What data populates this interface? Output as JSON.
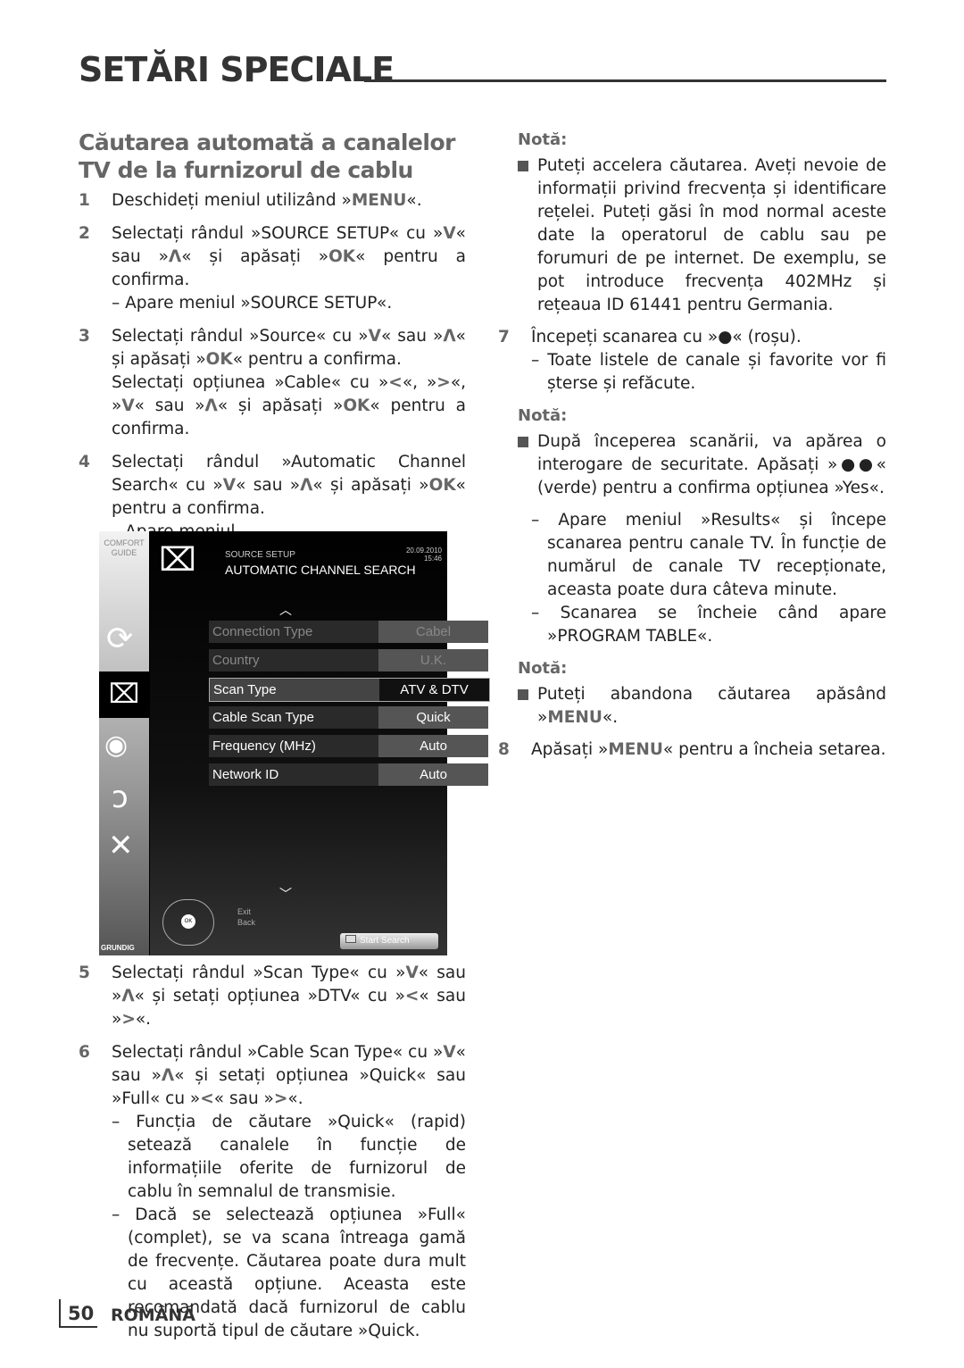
{
  "page_title": "SETĂRI SPECIALE",
  "section_heading": "Căutarea automată a canalelor TV de la furnizorul de cablu",
  "left_steps_top": [
    {
      "num": "1",
      "lines": [
        [
          {
            "t": "Deschideți meniul utilizând »"
          },
          {
            "t": "MENU",
            "k": true
          },
          {
            "t": "«."
          }
        ]
      ]
    },
    {
      "num": "2",
      "lines": [
        [
          {
            "t": "Selectați rândul »SOURCE SETUP« cu »"
          },
          {
            "t": "V",
            "k": true
          },
          {
            "t": "« sau »"
          },
          {
            "t": "Λ",
            "k": true
          },
          {
            "t": "« și apăsați »"
          },
          {
            "t": "OK",
            "k": true
          },
          {
            "t": "« pentru a confirma."
          }
        ]
      ],
      "subs": [
        "– Apare meniul »SOURCE SETUP«."
      ]
    },
    {
      "num": "3",
      "lines": [
        [
          {
            "t": "Selectați rândul »Source« cu »"
          },
          {
            "t": "V",
            "k": true
          },
          {
            "t": "« sau »"
          },
          {
            "t": "Λ",
            "k": true
          },
          {
            "t": "« și apăsați »"
          },
          {
            "t": "OK",
            "k": true
          },
          {
            "t": "« pentru a confirma."
          }
        ],
        [
          {
            "t": "Selectați opțiunea »Cable« cu »"
          },
          {
            "t": "<",
            "k": true
          },
          {
            "t": "«, »"
          },
          {
            "t": ">",
            "k": true
          },
          {
            "t": "«, »"
          },
          {
            "t": "V",
            "k": true
          },
          {
            "t": "« sau »"
          },
          {
            "t": "Λ",
            "k": true
          },
          {
            "t": "« și apăsați »"
          },
          {
            "t": "OK",
            "k": true
          },
          {
            "t": "« pentru a confirma."
          }
        ]
      ]
    },
    {
      "num": "4",
      "lines": [
        [
          {
            "t": "Selectați rândul »Automatic Channel Search« cu »"
          },
          {
            "t": "V",
            "k": true
          },
          {
            "t": "« sau »"
          },
          {
            "t": "Λ",
            "k": true
          },
          {
            "t": "« și apăsați »"
          },
          {
            "t": "OK",
            "k": true
          },
          {
            "t": "« pentru a confirma."
          }
        ]
      ],
      "subs": [
        "– Apare meniul."
      ]
    }
  ],
  "tv_menu": {
    "comfort_guide": "COMFORT GUIDE",
    "source_label": "SOURCE SETUP",
    "menu_title": "AUTOMATIC CHANNEL SEARCH",
    "date": "20.09.2010",
    "time": "15:46",
    "rows": [
      {
        "label": "Connection Type",
        "value": "Cabel",
        "state": "disabled"
      },
      {
        "label": "Country",
        "value": "U.K.",
        "state": "disabled"
      },
      {
        "label": "Scan Type",
        "value": "ATV & DTV",
        "state": "selected"
      },
      {
        "label": "Cable Scan Type",
        "value": "Quick",
        "state": "normal"
      },
      {
        "label": "Frequency (MHz)",
        "value": "Auto",
        "state": "normal"
      },
      {
        "label": "Network ID",
        "value": "Auto",
        "state": "normal"
      }
    ],
    "exit_label": "Exit",
    "back_label": "Back",
    "ok_label": "OK",
    "start_search": "Start Search",
    "brand": "GRUNDIG"
  },
  "left_steps_bottom": [
    {
      "num": "5",
      "lines": [
        [
          {
            "t": "Selectați rândul »Scan Type« cu »"
          },
          {
            "t": "V",
            "k": true
          },
          {
            "t": "« sau »"
          },
          {
            "t": "Λ",
            "k": true
          },
          {
            "t": "« și setați opțiunea »DTV« cu »"
          },
          {
            "t": "<",
            "k": true
          },
          {
            "t": "« sau »"
          },
          {
            "t": ">",
            "k": true
          },
          {
            "t": "«."
          }
        ]
      ]
    },
    {
      "num": "6",
      "lines": [
        [
          {
            "t": "Selectați rândul »Cable Scan Type« cu »"
          },
          {
            "t": "V",
            "k": true
          },
          {
            "t": "« sau »"
          },
          {
            "t": "Λ",
            "k": true
          },
          {
            "t": "« și setați opțiunea »Quick« sau »Full« cu »"
          },
          {
            "t": "<",
            "k": true
          },
          {
            "t": "« sau »"
          },
          {
            "t": ">",
            "k": true
          },
          {
            "t": "«."
          }
        ]
      ],
      "subs": [
        "– Funcția de căutare »Quick« (rapid) setează canalele în funcție de informațiile oferite de furnizorul de cablu în semnalul de transmisie.",
        "– Dacă se selectează opțiunea »Full« (complet), se va scana întreaga gamă de frecvențe. Căutarea poate dura mult cu această opțiune. Aceasta este recomandată dacă furnizorul de cablu nu suportă tipul de căutare »Quick."
      ]
    }
  ],
  "right": {
    "note1_heading": "Notă:",
    "note1_text": "Puteți accelera căutarea. Aveți nevoie de informații privind frecvența și identificare rețelei. Puteți găsi în mod normal aceste date la operatorul de cablu sau pe forumuri de pe internet. De exemplu, se pot introduce frecvența 402MHz și rețeaua ID 61441 pentru Germania.",
    "step7_num": "7",
    "step7_text": "Începeți scanarea cu »●« (roșu).",
    "step7_sub": "– Toate listele de canale și favorite vor fi șterse și refăcute.",
    "note2_heading": "Notă:",
    "note2_text": "După începerea scanării, va apărea o interogare de securitate. Apăsați »●●« (verde) pentru a confirma opțiunea »Yes«.",
    "sub_a": "– Apare meniul »Results« și începe scanarea pentru canale TV. În funcție de numărul de canale TV recepționate, aceasta poate dura câteva minute.",
    "sub_b": "– Scanarea se încheie când apare »PROGRAM TABLE«.",
    "note3_heading": "Notă:",
    "note3_pre": "Puteți abandona căutarea apăsând »",
    "note3_key": "MENU",
    "note3_post": "«.",
    "step8_num": "8",
    "step8_pre": "Apăsați »",
    "step8_key": "MENU",
    "step8_post": "« pentru a încheia setarea."
  },
  "footer": {
    "page_number": "50",
    "language": "ROMÂNĂ"
  }
}
